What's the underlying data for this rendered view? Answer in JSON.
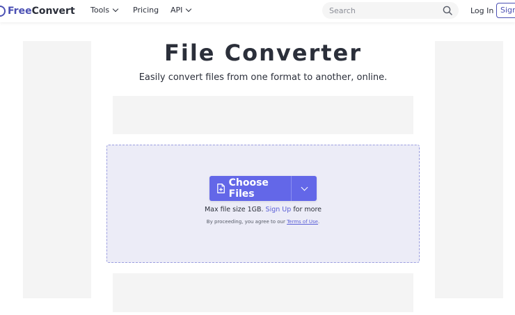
{
  "header": {
    "logo": {
      "part1": "Free",
      "part2": "Convert"
    },
    "nav": [
      {
        "label": "Tools",
        "has_dropdown": true
      },
      {
        "label": "Pricing",
        "has_dropdown": false
      },
      {
        "label": "API",
        "has_dropdown": true
      }
    ],
    "search": {
      "placeholder": "Search",
      "icon": "search-icon"
    },
    "login_label": "Log In",
    "signup_label": "Sign"
  },
  "main": {
    "title": "File Converter",
    "subtitle": "Easily convert files from one format to another, online.",
    "choose_files_label": "Choose Files",
    "max_size": {
      "prefix": "Max file size 1GB.",
      "link": "Sign Up",
      "suffix": "for more"
    },
    "terms": {
      "prefix": "By proceeding, you agree to our",
      "link": "Terms of Use",
      "suffix": "."
    }
  },
  "colors": {
    "brand": "#4a4fb3",
    "button": "#6367e8",
    "dropzone_bg": "#ececf7",
    "ad_bg": "#f4f4f4"
  }
}
